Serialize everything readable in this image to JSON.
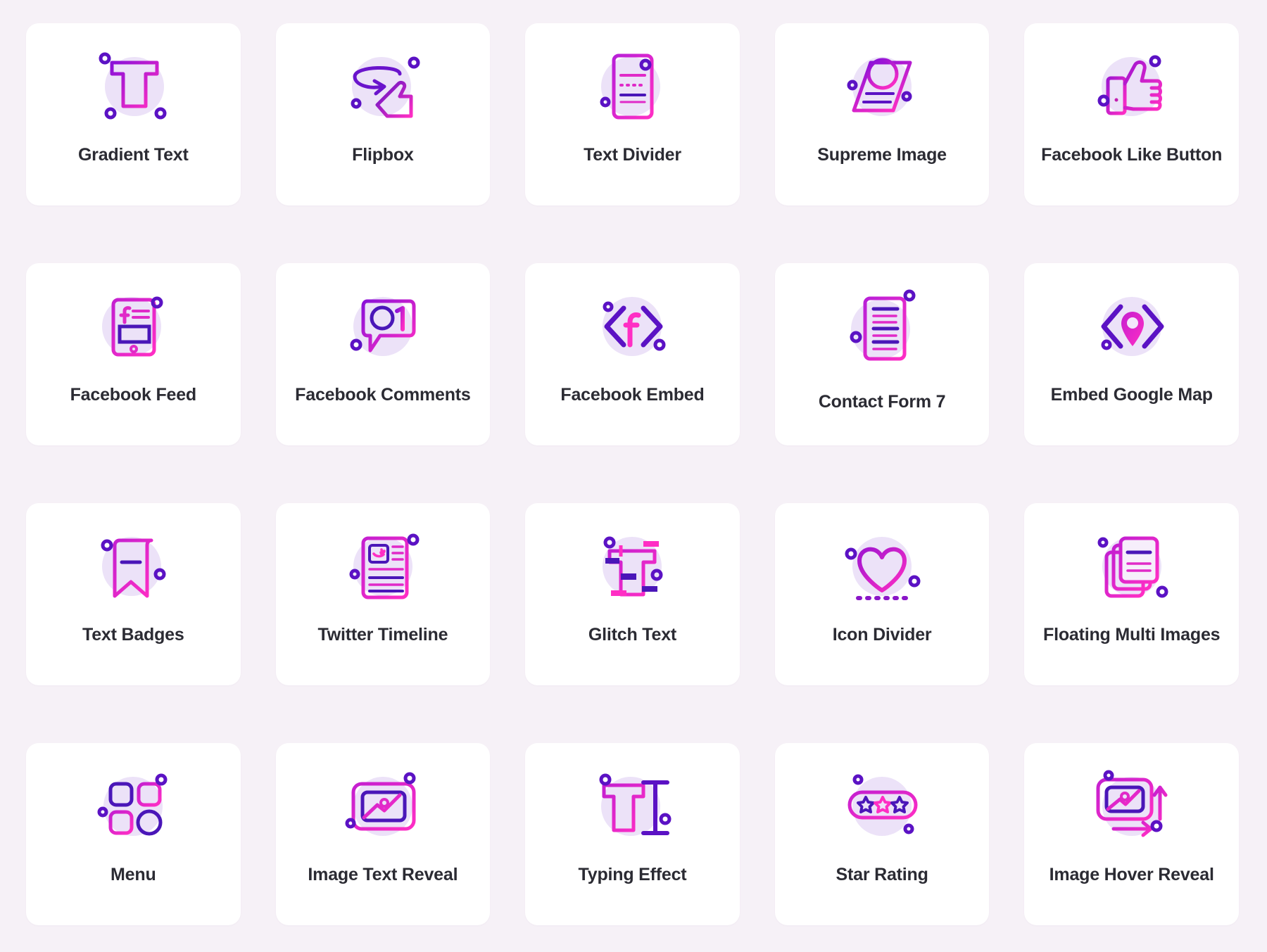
{
  "page": {
    "background_color": "#f6f1f7",
    "card_color": "#ffffff",
    "label_color": "#2b2b33",
    "icon_bubble_color": "#ece2f8",
    "gradient_start": "#5b12c4",
    "gradient_end": "#ff2ec4",
    "columns": 5,
    "rows": 4
  },
  "widgets": [
    {
      "label": "Gradient Text",
      "icon": "gradient-text-icon"
    },
    {
      "label": "Flipbox",
      "icon": "flipbox-icon"
    },
    {
      "label": "Text Divider",
      "icon": "text-divider-icon"
    },
    {
      "label": "Supreme Image",
      "icon": "supreme-image-icon"
    },
    {
      "label": "Facebook Like Button",
      "icon": "thumbs-up-icon"
    },
    {
      "label": "Facebook Feed",
      "icon": "facebook-feed-icon"
    },
    {
      "label": "Facebook Comments",
      "icon": "comment-bubble-icon"
    },
    {
      "label": "Facebook Embed",
      "icon": "facebook-embed-code-icon"
    },
    {
      "label": "Contact Form 7",
      "icon": "contact-form-document-icon"
    },
    {
      "label": "Embed Google Map",
      "icon": "map-pin-code-icon"
    },
    {
      "label": "Text Badges",
      "icon": "bookmark-badge-icon"
    },
    {
      "label": "Twitter Timeline",
      "icon": "twitter-timeline-icon"
    },
    {
      "label": "Glitch Text",
      "icon": "glitch-text-icon"
    },
    {
      "label": "Icon Divider",
      "icon": "heart-divider-icon"
    },
    {
      "label": "Floating Multi Images",
      "icon": "stacked-pages-icon"
    },
    {
      "label": "Menu",
      "icon": "menu-grid-icon"
    },
    {
      "label": "Image Text Reveal",
      "icon": "picture-frame-icon"
    },
    {
      "label": "Typing Effect",
      "icon": "typing-cursor-icon"
    },
    {
      "label": "Star Rating",
      "icon": "star-rating-icon"
    },
    {
      "label": "Image Hover Reveal",
      "icon": "image-hover-arrows-icon"
    }
  ]
}
